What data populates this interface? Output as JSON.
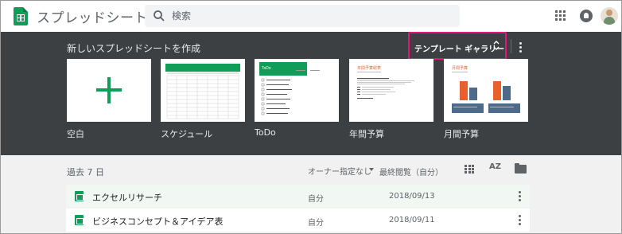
{
  "app": {
    "title": "スプレッドシート"
  },
  "search": {
    "placeholder": "検索"
  },
  "templates": {
    "heading": "新しいスプレッドシートを作成",
    "gallery_label": "テンプレート ギャラリー",
    "items": [
      {
        "label": "空白"
      },
      {
        "label": "スケジュール"
      },
      {
        "label": "ToDo"
      },
      {
        "label": "年間予算"
      },
      {
        "label": "月間予算"
      }
    ],
    "thumb_text": {
      "todo_title": "ToDo",
      "annual_title": "年間予算総表",
      "monthly_title": "月間予算"
    }
  },
  "recent": {
    "heading": "過去 7 日",
    "owner_filter": "オーナー指定なし",
    "sort_label": "最終閲覧（自分）",
    "az_label": "AZ"
  },
  "files": [
    {
      "name": "エクセルリサーチ",
      "owner": "自分",
      "date": "2018/09/13"
    },
    {
      "name": "ビジネスコンセプト＆アイデア表",
      "owner": "自分",
      "date": "2018/09/11"
    }
  ],
  "colors": {
    "sheets_green": "#0f9d58",
    "dark_panel": "#3c4043",
    "highlight_border": "#e5157a"
  }
}
